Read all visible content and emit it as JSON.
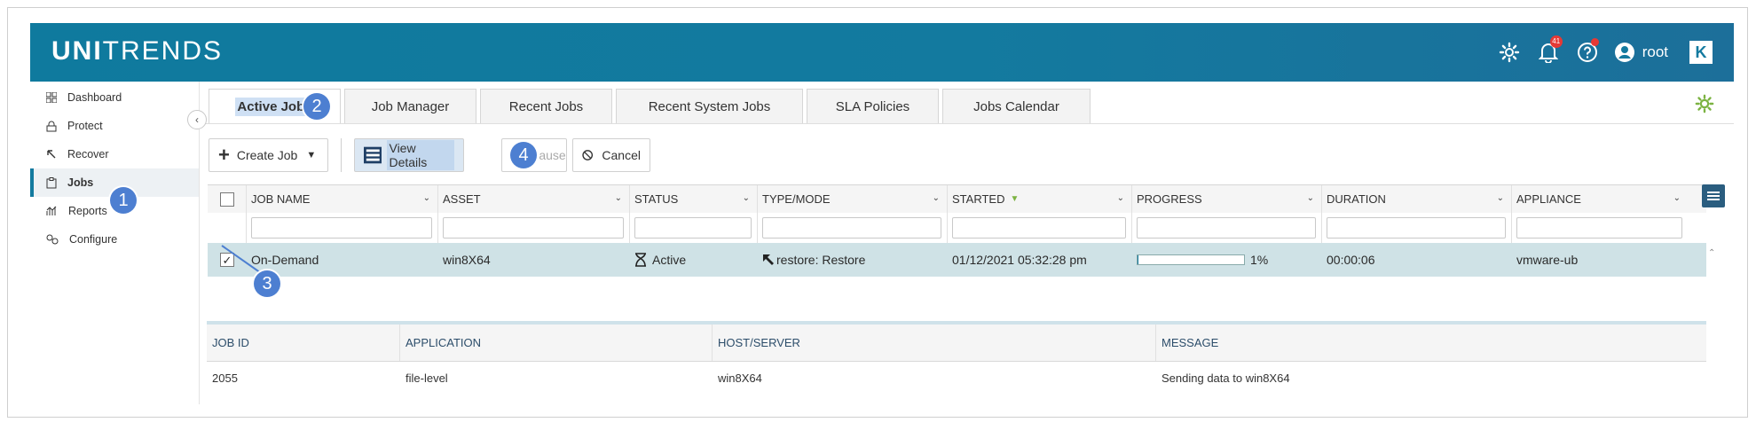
{
  "brand": {
    "logo_bold": "UNI",
    "logo_thin": "TRENDS"
  },
  "header": {
    "notification_count": "41",
    "username": "root",
    "k_logo": "K"
  },
  "sidebar": {
    "items": [
      {
        "label": "Dashboard",
        "icon": "dashboard-icon"
      },
      {
        "label": "Protect",
        "icon": "lock-icon"
      },
      {
        "label": "Recover",
        "icon": "recover-icon"
      },
      {
        "label": "Jobs",
        "icon": "clipboard-icon",
        "active": true
      },
      {
        "label": "Reports",
        "icon": "reports-icon"
      },
      {
        "label": "Configure",
        "icon": "configure-icon"
      }
    ]
  },
  "tabs": [
    "Active Jobs",
    "Job Manager",
    "Recent Jobs",
    "Recent System Jobs",
    "SLA Policies",
    "Jobs Calendar"
  ],
  "toolbar": {
    "create_job": "Create Job",
    "view_details": "View Details",
    "pause": "Pause",
    "cancel": "Cancel"
  },
  "grid": {
    "columns": [
      "JOB NAME",
      "ASSET",
      "STATUS",
      "TYPE/MODE",
      "STARTED",
      "PROGRESS",
      "DURATION",
      "APPLIANCE"
    ],
    "row": {
      "job_name": "On-Demand",
      "asset": "win8X64",
      "status": "Active",
      "type_mode": "restore: Restore",
      "started": "01/12/2021 05:32:28 pm",
      "progress": 0.01,
      "progress_text": "1%",
      "duration": "00:00:06",
      "appliance": "vmware-ub"
    }
  },
  "detail": {
    "columns": [
      "JOB ID",
      "APPLICATION",
      "HOST/SERVER",
      "MESSAGE"
    ],
    "row": [
      "2055",
      "file-level",
      "win8X64",
      "Sending data to win8X64"
    ]
  },
  "callouts": {
    "c1": "1",
    "c2": "2",
    "c3": "3",
    "c4": "4"
  },
  "colors": {
    "header": "#137a9f",
    "selected_row": "#cfe2e6",
    "callout": "#4d7fd1",
    "accent_green": "#7cb342"
  }
}
